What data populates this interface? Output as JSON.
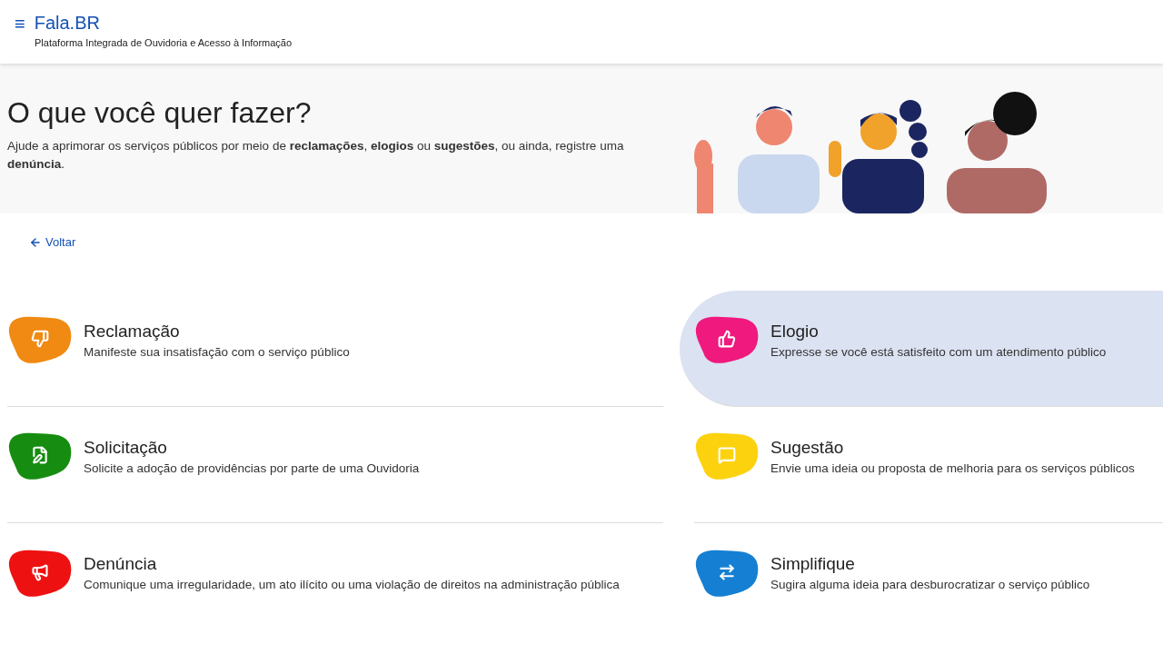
{
  "header": {
    "menu_icon": "≡",
    "title": "Fala.BR",
    "subtitle": "Plataforma Integrada de Ouvidoria e Acesso à Informação"
  },
  "hero": {
    "heading": "O que você quer fazer?",
    "text": "Ajude a aprimorar os serviços públicos por meio de **reclamações**, **elogios** ou **sugestões**, ou ainda, registre uma **denúncia**."
  },
  "back_link": "Voltar",
  "options": [
    {
      "kind": "complaint",
      "title": "Reclamação",
      "description": "Manifeste sua insatisfação com o serviço público",
      "color": "#f08a12",
      "selected": false
    },
    {
      "kind": "praise",
      "title": "Elogio",
      "description": "Expresse se você está satisfeito com um atendimento público",
      "color": "#f0197d",
      "selected": true
    },
    {
      "kind": "request",
      "title": "Solicitação",
      "description": "Solicite a adoção de providências por parte de uma Ouvidoria",
      "color": "#168d10",
      "selected": false
    },
    {
      "kind": "suggestion",
      "title": "Sugestão",
      "description": "Envie uma ideia ou proposta de melhoria para os serviços públicos",
      "color": "#fcd20f",
      "selected": false
    },
    {
      "kind": "report",
      "title": "Denúncia",
      "description": "Comunique uma irregularidade, um ato ilícito ou uma violação de direitos na administração pública",
      "color": "#ee1111",
      "selected": false
    },
    {
      "kind": "simplify",
      "title": "Simplifique",
      "description": "Sugira alguma ideia para desburocratizar o serviço público",
      "color": "#1580d3",
      "selected": false
    }
  ]
}
